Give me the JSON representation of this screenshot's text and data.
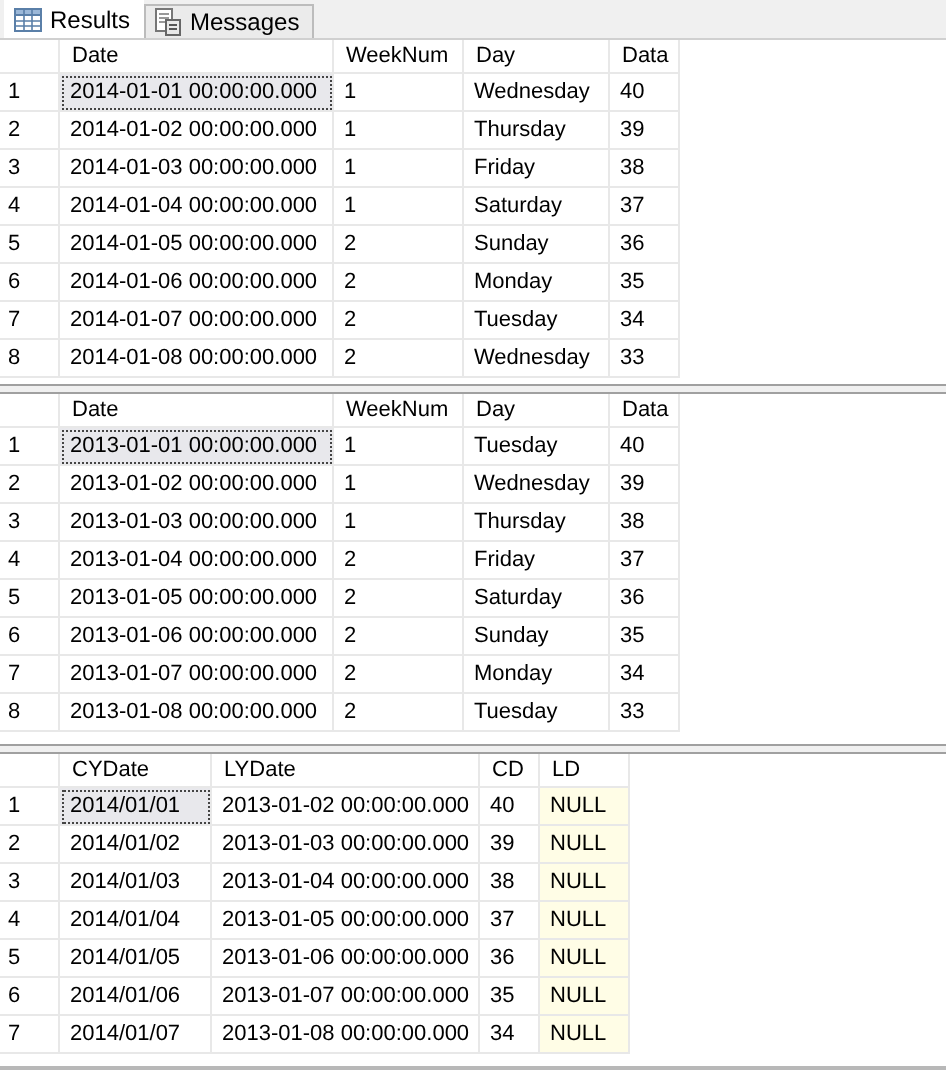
{
  "tabs": [
    {
      "label": "Results",
      "selected": true
    },
    {
      "label": "Messages",
      "selected": false
    }
  ],
  "grids": [
    {
      "columns": [
        {
          "label": "Date",
          "highlighted": false
        },
        {
          "label": "WeekNum",
          "highlighted": false
        },
        {
          "label": "Day",
          "highlighted": false
        },
        {
          "label": "Data",
          "highlighted": false
        }
      ],
      "rows": [
        {
          "number": "1",
          "current": true,
          "cells": [
            "2014-01-01 00:00:00.000",
            "1",
            "Wednesday",
            "40"
          ]
        },
        {
          "number": "2",
          "current": false,
          "cells": [
            "2014-01-02 00:00:00.000",
            "1",
            "Thursday",
            "39"
          ]
        },
        {
          "number": "3",
          "current": false,
          "cells": [
            "2014-01-03 00:00:00.000",
            "1",
            "Friday",
            "38"
          ]
        },
        {
          "number": "4",
          "current": false,
          "cells": [
            "2014-01-04 00:00:00.000",
            "1",
            "Saturday",
            "37"
          ]
        },
        {
          "number": "5",
          "current": false,
          "cells": [
            "2014-01-05 00:00:00.000",
            "2",
            "Sunday",
            "36"
          ]
        },
        {
          "number": "6",
          "current": false,
          "cells": [
            "2014-01-06 00:00:00.000",
            "2",
            "Monday",
            "35"
          ]
        },
        {
          "number": "7",
          "current": false,
          "cells": [
            "2014-01-07 00:00:00.000",
            "2",
            "Tuesday",
            "34"
          ]
        },
        {
          "number": "8",
          "current": false,
          "cells": [
            "2014-01-08 00:00:00.000",
            "2",
            "Wednesday",
            "33"
          ]
        }
      ]
    },
    {
      "columns": [
        {
          "label": "Date",
          "highlighted": false
        },
        {
          "label": "WeekNum",
          "highlighted": false
        },
        {
          "label": "Day",
          "highlighted": false
        },
        {
          "label": "Data",
          "highlighted": false
        }
      ],
      "rows": [
        {
          "number": "1",
          "current": true,
          "cells": [
            "2013-01-01 00:00:00.000",
            "1",
            "Tuesday",
            "40"
          ]
        },
        {
          "number": "2",
          "current": false,
          "cells": [
            "2013-01-02 00:00:00.000",
            "1",
            "Wednesday",
            "39"
          ]
        },
        {
          "number": "3",
          "current": false,
          "cells": [
            "2013-01-03 00:00:00.000",
            "1",
            "Thursday",
            "38"
          ]
        },
        {
          "number": "4",
          "current": false,
          "cells": [
            "2013-01-04 00:00:00.000",
            "2",
            "Friday",
            "37"
          ]
        },
        {
          "number": "5",
          "current": false,
          "cells": [
            "2013-01-05 00:00:00.000",
            "2",
            "Saturday",
            "36"
          ]
        },
        {
          "number": "6",
          "current": false,
          "cells": [
            "2013-01-06 00:00:00.000",
            "2",
            "Sunday",
            "35"
          ]
        },
        {
          "number": "7",
          "current": false,
          "cells": [
            "2013-01-07 00:00:00.000",
            "2",
            "Monday",
            "34"
          ]
        },
        {
          "number": "8",
          "current": false,
          "cells": [
            "2013-01-08 00:00:00.000",
            "2",
            "Tuesday",
            "33"
          ]
        }
      ]
    },
    {
      "columns": [
        {
          "label": "CYDate",
          "highlighted": false
        },
        {
          "label": "LYDate",
          "highlighted": false
        },
        {
          "label": "CD",
          "highlighted": false
        },
        {
          "label": "LD",
          "highlighted": true
        }
      ],
      "rows": [
        {
          "number": "1",
          "current": true,
          "cells": [
            "2014/01/01",
            "2013-01-02 00:00:00.000",
            "40",
            "NULL"
          ]
        },
        {
          "number": "2",
          "current": false,
          "cells": [
            "2014/01/02",
            "2013-01-03 00:00:00.000",
            "39",
            "NULL"
          ]
        },
        {
          "number": "3",
          "current": false,
          "cells": [
            "2014/01/03",
            "2013-01-04 00:00:00.000",
            "38",
            "NULL"
          ]
        },
        {
          "number": "4",
          "current": false,
          "cells": [
            "2014/01/04",
            "2013-01-05 00:00:00.000",
            "37",
            "NULL"
          ]
        },
        {
          "number": "5",
          "current": false,
          "cells": [
            "2014/01/05",
            "2013-01-06 00:00:00.000",
            "36",
            "NULL"
          ]
        },
        {
          "number": "6",
          "current": false,
          "cells": [
            "2014/01/06",
            "2013-01-07 00:00:00.000",
            "35",
            "NULL"
          ]
        },
        {
          "number": "7",
          "current": false,
          "cells": [
            "2014/01/07",
            "2013-01-08 00:00:00.000",
            "34",
            "NULL"
          ]
        }
      ]
    }
  ]
}
